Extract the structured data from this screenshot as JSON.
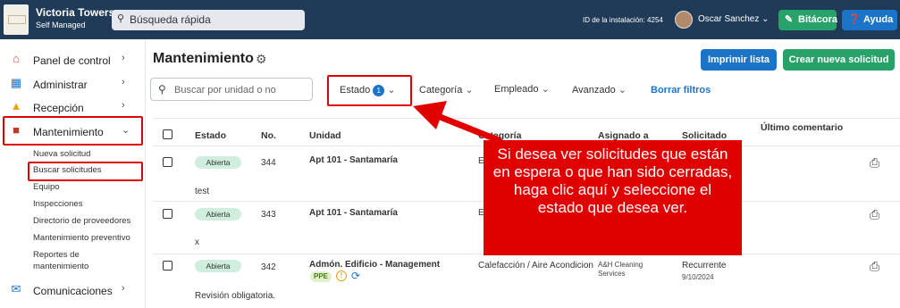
{
  "topbar": {
    "brand_name": "Victoria Towers",
    "brand_sub": "Self Managed",
    "search_label": "Búsqueda rápida",
    "install_id": "ID de la instalación: 4254",
    "user_name": "Oscar Sanchez",
    "user_chevron": "⌄",
    "bitacora": "Bitácora",
    "ayuda": "Ayuda"
  },
  "sidebar": {
    "items": [
      {
        "label": "Panel de control",
        "icon": "home-icon"
      },
      {
        "label": "Administrar",
        "icon": "building-icon"
      },
      {
        "label": "Recepción",
        "icon": "reception-bell-icon"
      },
      {
        "label": "Mantenimiento",
        "icon": "toolbox-icon"
      },
      {
        "label": "Comunicaciones",
        "icon": "mail-icon"
      }
    ],
    "subitems": [
      "Nueva solicitud",
      "Buscar solicitudes",
      "Equipo",
      "Inspecciones",
      "Directorio de proveedores",
      "Mantenimiento preventivo",
      "Reportes de mantenimiento"
    ]
  },
  "main": {
    "title": "Mantenimiento",
    "print_button": "Imprimir lista",
    "new_button": "Crear nueva solicitud",
    "search_placeholder": "Buscar por unidad o no",
    "filters": {
      "estado": "Estado",
      "estado_count": "1",
      "categoria": "Categoría",
      "empleado": "Empleado",
      "avanzado": "Avanzado",
      "clear": "Borrar filtros"
    },
    "columns": [
      "Estado",
      "No.",
      "Unidad",
      "Categoría",
      "Asignado a",
      "Solicitado",
      "Último comentario"
    ],
    "rows": [
      {
        "status": "Abierta",
        "number": "344",
        "unit": "Apt 101 - Santamaría",
        "category": "E",
        "comment": "test"
      },
      {
        "status": "Abierta",
        "number": "343",
        "unit": "Apt 101 - Santamaría",
        "category": "E",
        "comment": "x"
      },
      {
        "status": "Abierta",
        "number": "342",
        "unit": "Admón. Edificio - Management",
        "category": "Calefacción / Aire Acondicion",
        "assigned": "A&H Cleaning Services",
        "requested": "Recurrente",
        "requested_date": "9/10/2024",
        "tag": "PPE",
        "comment": "Revisión obligatoria."
      }
    ]
  },
  "callout": {
    "text": "Si desea ver solicitudes que están en espera o que han sido cerradas, haga clic aquí y seleccione el estado que desea ver."
  },
  "colors": {
    "topbar": "#1f3b57",
    "primary": "#1c74c9",
    "success": "#27a36a",
    "highlight": "#e00000",
    "status_open": "#cfeedd"
  }
}
